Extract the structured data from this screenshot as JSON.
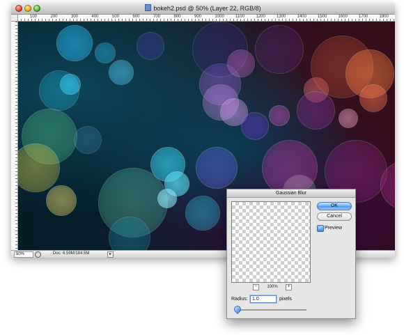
{
  "document_window": {
    "title": "bokeh2.psd @ 50% (Layer 22, RGB/8)",
    "ruler_ticks": [
      "100",
      "200",
      "300",
      "400",
      "500",
      "600",
      "700",
      "800",
      "900",
      "1000",
      "1100",
      "1200",
      "1300",
      "1400",
      "1500",
      "1600",
      "1700",
      "1800"
    ],
    "status": {
      "zoom": "50%",
      "doc_size": "Doc: 6.59M/184.5M"
    }
  },
  "gaussian_blur_dialog": {
    "title": "Gaussian Blur",
    "ok_label": "OK",
    "cancel_label": "Cancel",
    "preview_label": "Preview",
    "preview_checked": true,
    "preview_zoom": "100%",
    "zoom_minus": "−",
    "zoom_plus": "+",
    "radius_label": "Radius:",
    "radius_value": "1.0",
    "radius_units": "pixels",
    "radius_slider_fraction": 0.0
  },
  "colors": {
    "accent_blue": "#4d96e8",
    "canvas_dark": "#06222e"
  },
  "icons": {
    "close": "close-icon",
    "minimize": "minimize-icon",
    "zoom": "zoom-icon",
    "document": "psd-document-icon"
  }
}
